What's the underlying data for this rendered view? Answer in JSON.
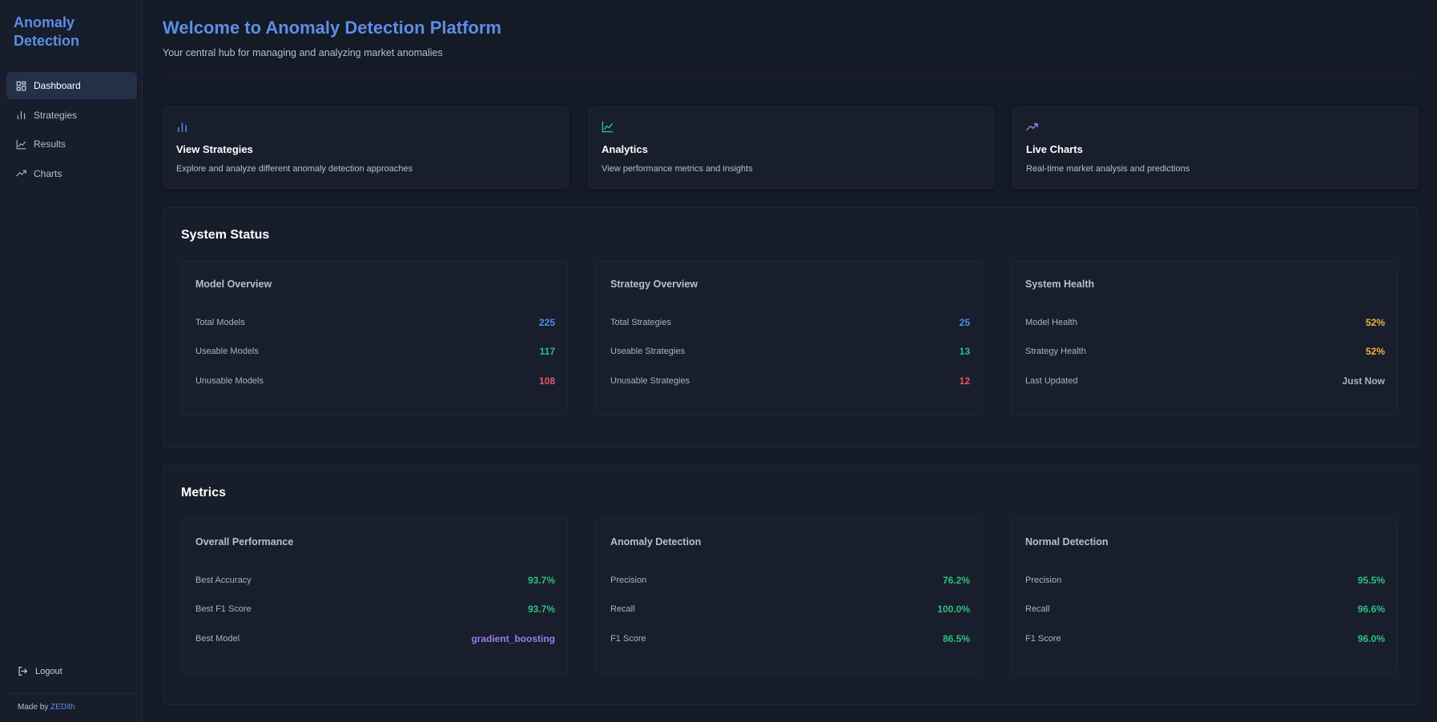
{
  "sidebar": {
    "brand": "Anomaly Detection",
    "nav": [
      {
        "label": "Dashboard",
        "icon": "dashboard-icon",
        "active": true
      },
      {
        "label": "Strategies",
        "icon": "bar-chart-icon",
        "active": false
      },
      {
        "label": "Results",
        "icon": "line-chart-icon",
        "active": false
      },
      {
        "label": "Charts",
        "icon": "trending-up-icon",
        "active": false
      }
    ],
    "logout_label": "Logout",
    "made_by_prefix": "Made by",
    "made_by_link": "ZEDith"
  },
  "header": {
    "title": "Welcome to Anomaly Detection Platform",
    "subtitle": "Your central hub for managing and analyzing market anomalies"
  },
  "cards": [
    {
      "title": "View Strategies",
      "desc": "Explore and analyze different anomaly detection approaches",
      "icon": "bar-chart-icon",
      "color": "#4d8ff0"
    },
    {
      "title": "Analytics",
      "desc": "View performance metrics and insights",
      "icon": "line-chart-icon",
      "color": "#2fc07f"
    },
    {
      "title": "Live Charts",
      "desc": "Real-time market analysis and predictions",
      "icon": "trending-up-icon",
      "color": "#9b7bf0"
    }
  ],
  "system_status": {
    "title": "System Status",
    "panels": [
      {
        "title": "Model Overview",
        "rows": [
          {
            "label": "Total Models",
            "value": "225",
            "color": "blue"
          },
          {
            "label": "Useable Models",
            "value": "117",
            "color": "green"
          },
          {
            "label": "Unusable Models",
            "value": "108",
            "color": "red"
          }
        ]
      },
      {
        "title": "Strategy Overview",
        "rows": [
          {
            "label": "Total Strategies",
            "value": "25",
            "color": "blue"
          },
          {
            "label": "Useable Strategies",
            "value": "13",
            "color": "green"
          },
          {
            "label": "Unusable Strategies",
            "value": "12",
            "color": "red"
          }
        ]
      },
      {
        "title": "System Health",
        "rows": [
          {
            "label": "Model Health",
            "value": "52%",
            "color": "yellow"
          },
          {
            "label": "Strategy Health",
            "value": "52%",
            "color": "yellow"
          },
          {
            "label": "Last Updated",
            "value": "Just Now",
            "color": "gray"
          }
        ]
      }
    ]
  },
  "metrics": {
    "title": "Metrics",
    "panels": [
      {
        "title": "Overall Performance",
        "rows": [
          {
            "label": "Best Accuracy",
            "value": "93.7%",
            "color": "green"
          },
          {
            "label": "Best F1 Score",
            "value": "93.7%",
            "color": "green"
          },
          {
            "label": "Best Model",
            "value": "gradient_boosting",
            "color": "purple"
          }
        ]
      },
      {
        "title": "Anomaly Detection",
        "rows": [
          {
            "label": "Precision",
            "value": "76.2%",
            "color": "green"
          },
          {
            "label": "Recall",
            "value": "100.0%",
            "color": "green"
          },
          {
            "label": "F1 Score",
            "value": "86.5%",
            "color": "green"
          }
        ]
      },
      {
        "title": "Normal Detection",
        "rows": [
          {
            "label": "Precision",
            "value": "95.5%",
            "color": "green"
          },
          {
            "label": "Recall",
            "value": "96.6%",
            "color": "green"
          },
          {
            "label": "F1 Score",
            "value": "96.0%",
            "color": "green"
          }
        ]
      }
    ]
  }
}
